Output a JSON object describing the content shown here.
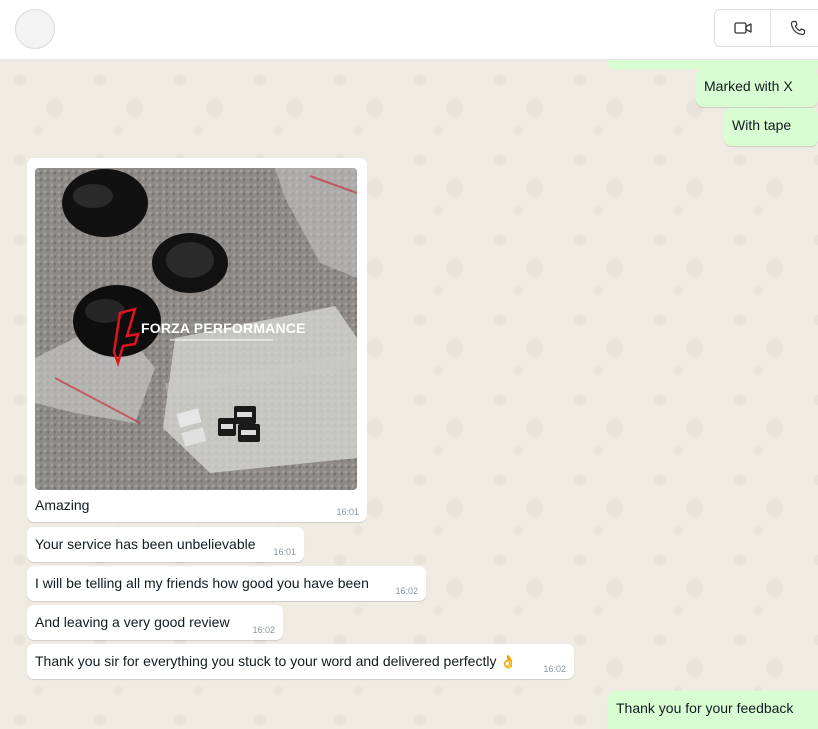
{
  "header": {
    "video_icon": "video-camera-icon",
    "voice_icon": "phone-icon"
  },
  "messages": {
    "out_1": {
      "text": "Marked with X"
    },
    "out_2": {
      "text": "With tape"
    },
    "image_msg": {
      "caption": "Amazing",
      "time": "16:01",
      "watermark": "FORZA PERFORMANCE"
    },
    "in_1": {
      "text": "Your service has been unbelievable",
      "time": "16:01"
    },
    "in_2": {
      "text": "I will be telling all my friends how good you have been",
      "time": "16:02"
    },
    "in_3": {
      "text": "And leaving a very good review",
      "time": "16:02"
    },
    "in_4": {
      "text": "Thank you sir for everything you stuck to your word and delivered perfectly",
      "emoji": "👌",
      "time": "16:02"
    },
    "out_3": {
      "text": "Thank you for your feedback"
    }
  },
  "colors": {
    "incoming": "#ffffff",
    "outgoing": "#d9fdd3",
    "chat_bg": "#efeae2",
    "watermark_red": "#e0141f"
  }
}
